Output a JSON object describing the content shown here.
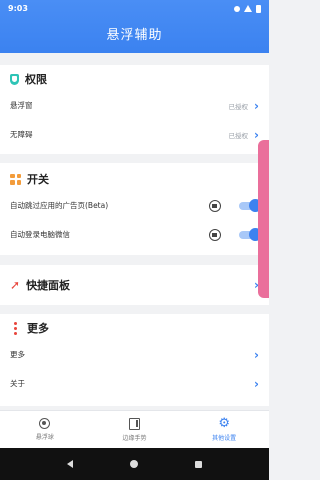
{
  "status_bar": {
    "time": "9:03"
  },
  "app": {
    "title": "悬浮辅助"
  },
  "permissions": {
    "title": "权限",
    "items": [
      {
        "label": "悬浮窗",
        "status": "已授权"
      },
      {
        "label": "无障碍",
        "status": "已授权"
      }
    ]
  },
  "switches": {
    "title": "开关",
    "items": [
      {
        "label": "自动跳过应用的广告页(Beta)",
        "enabled": true
      },
      {
        "label": "自动登录电脑微信",
        "enabled": true
      }
    ]
  },
  "quick_panel": {
    "title": "快捷面板"
  },
  "more": {
    "title": "更多",
    "items": [
      {
        "label": "更多"
      },
      {
        "label": "关于"
      }
    ]
  },
  "bottom_nav": {
    "items": [
      {
        "label": "悬浮球"
      },
      {
        "label": "边缘手势"
      },
      {
        "label": "其他设置"
      }
    ],
    "active_index": 2
  },
  "colors": {
    "accent": "#3b82f0",
    "side_handle": "#ea6f9b"
  }
}
